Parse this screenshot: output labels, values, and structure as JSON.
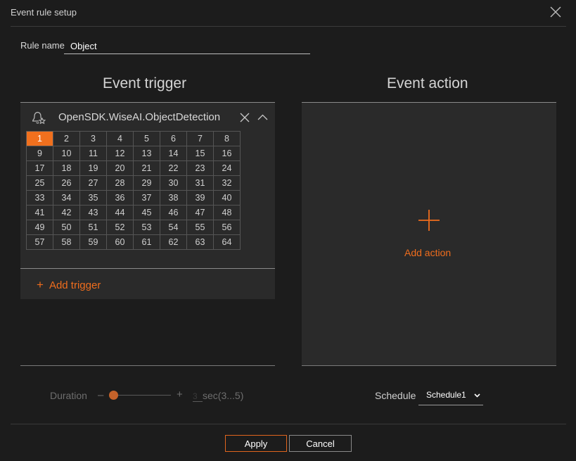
{
  "window": {
    "title": "Event rule setup"
  },
  "rule": {
    "label": "Rule name",
    "value": "Object"
  },
  "trigger_section": {
    "title": "Event trigger",
    "trigger_name": "OpenSDK.WiseAI.ObjectDetection",
    "channels": [
      1,
      2,
      3,
      4,
      5,
      6,
      7,
      8,
      9,
      10,
      11,
      12,
      13,
      14,
      15,
      16,
      17,
      18,
      19,
      20,
      21,
      22,
      23,
      24,
      25,
      26,
      27,
      28,
      29,
      30,
      31,
      32,
      33,
      34,
      35,
      36,
      37,
      38,
      39,
      40,
      41,
      42,
      43,
      44,
      45,
      46,
      47,
      48,
      49,
      50,
      51,
      52,
      53,
      54,
      55,
      56,
      57,
      58,
      59,
      60,
      61,
      62,
      63,
      64
    ],
    "selected_channel": 1,
    "add_trigger_label": "Add trigger"
  },
  "action_section": {
    "title": "Event action",
    "add_action_label": "Add action"
  },
  "duration": {
    "label": "Duration",
    "minus": "–",
    "plus": "+",
    "value": "3",
    "unit": "sec(3...5)",
    "slider_fraction": 0
  },
  "schedule": {
    "label": "Schedule",
    "selected": "Schedule1"
  },
  "buttons": {
    "apply": "Apply",
    "cancel": "Cancel"
  },
  "colors": {
    "accent": "#ef6d1d",
    "background": "#1c1c1c",
    "panel": "#2a2a2a"
  }
}
